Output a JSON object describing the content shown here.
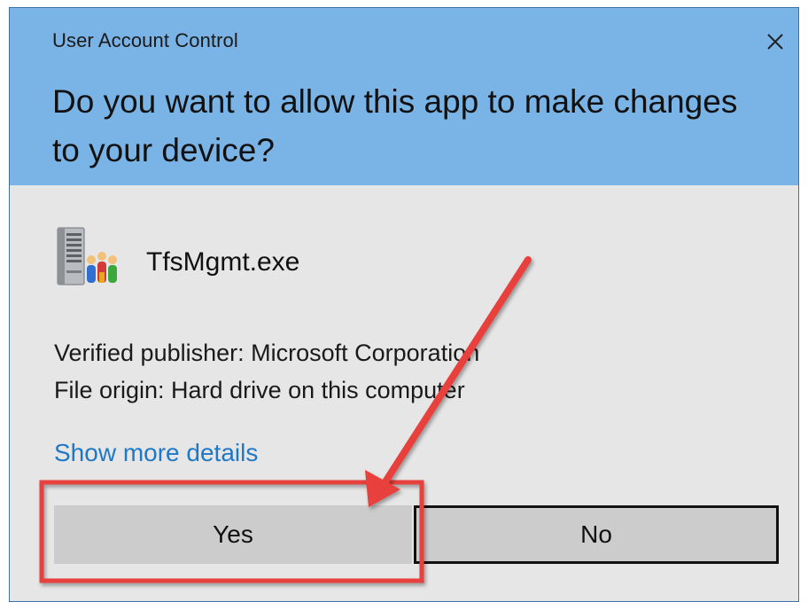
{
  "dialog": {
    "window_title": "User Account Control",
    "close_glyph": "✕",
    "prompt": "Do you want to allow this app to make changes to your device?",
    "header_color": "#7ab4e6",
    "body_color": "#e6e6e6"
  },
  "app": {
    "icon": "server-users-icon",
    "name": "TfsMgmt.exe"
  },
  "details": {
    "publisher": "Verified publisher: Microsoft Corporation",
    "origin": "File origin: Hard drive on this computer",
    "show_more": "Show more details",
    "link_color": "#1e78c8"
  },
  "buttons": {
    "yes": "Yes",
    "no": "No"
  },
  "annotation": {
    "color": "#e8403e",
    "arrow_icon": "red-arrow",
    "highlight": "red-box around Yes button"
  }
}
